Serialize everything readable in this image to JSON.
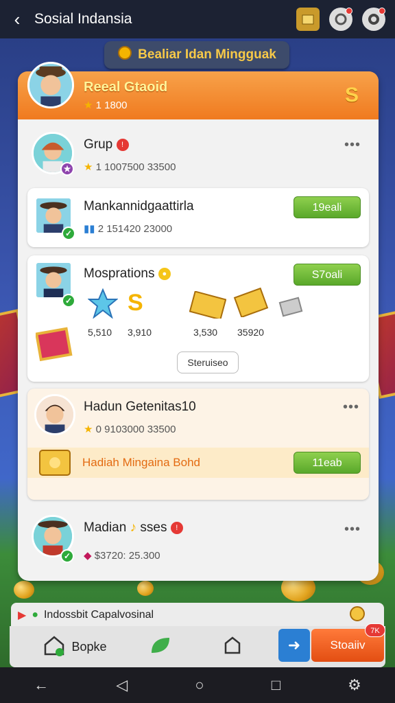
{
  "appbar": {
    "title": "Sosial Indansia",
    "back": "‹"
  },
  "banner": {
    "text": "Bealiar Idan Mingguak"
  },
  "panel_header": {
    "name": "Reeal Gtaoid",
    "points": "1 1800",
    "badge": "S"
  },
  "rows": {
    "grup": {
      "title": "Grup",
      "stat": "1 1007500 33500"
    },
    "mankan": {
      "title": "Mankannidgaattirla",
      "stat": "2 151420 23000",
      "button": "19eali"
    },
    "mosp": {
      "title": "Mosprations",
      "button": "S7oali",
      "items": [
        "5,510",
        "3,910",
        "3,530",
        "35920"
      ],
      "secondary_button": "Steruiseo"
    },
    "hadun": {
      "title": "Hadun Getenitas10",
      "stat": "0 9103000 33500"
    },
    "hadiah": {
      "title": "Hadiah Mingaina Bohd",
      "button": "11eab"
    },
    "madian": {
      "title": "Madian",
      "title_suffix": "sses",
      "stat": "$3720: 25.300"
    }
  },
  "notification": {
    "text": "Indossbit Capalvosinal"
  },
  "tabbar": {
    "home_label": "Bopke",
    "action_label": "Stoaiiv",
    "action_badge": "7K"
  },
  "colors": {
    "accent": "#f07a1f",
    "green": "#59a82a",
    "blue": "#2b7fd3"
  }
}
